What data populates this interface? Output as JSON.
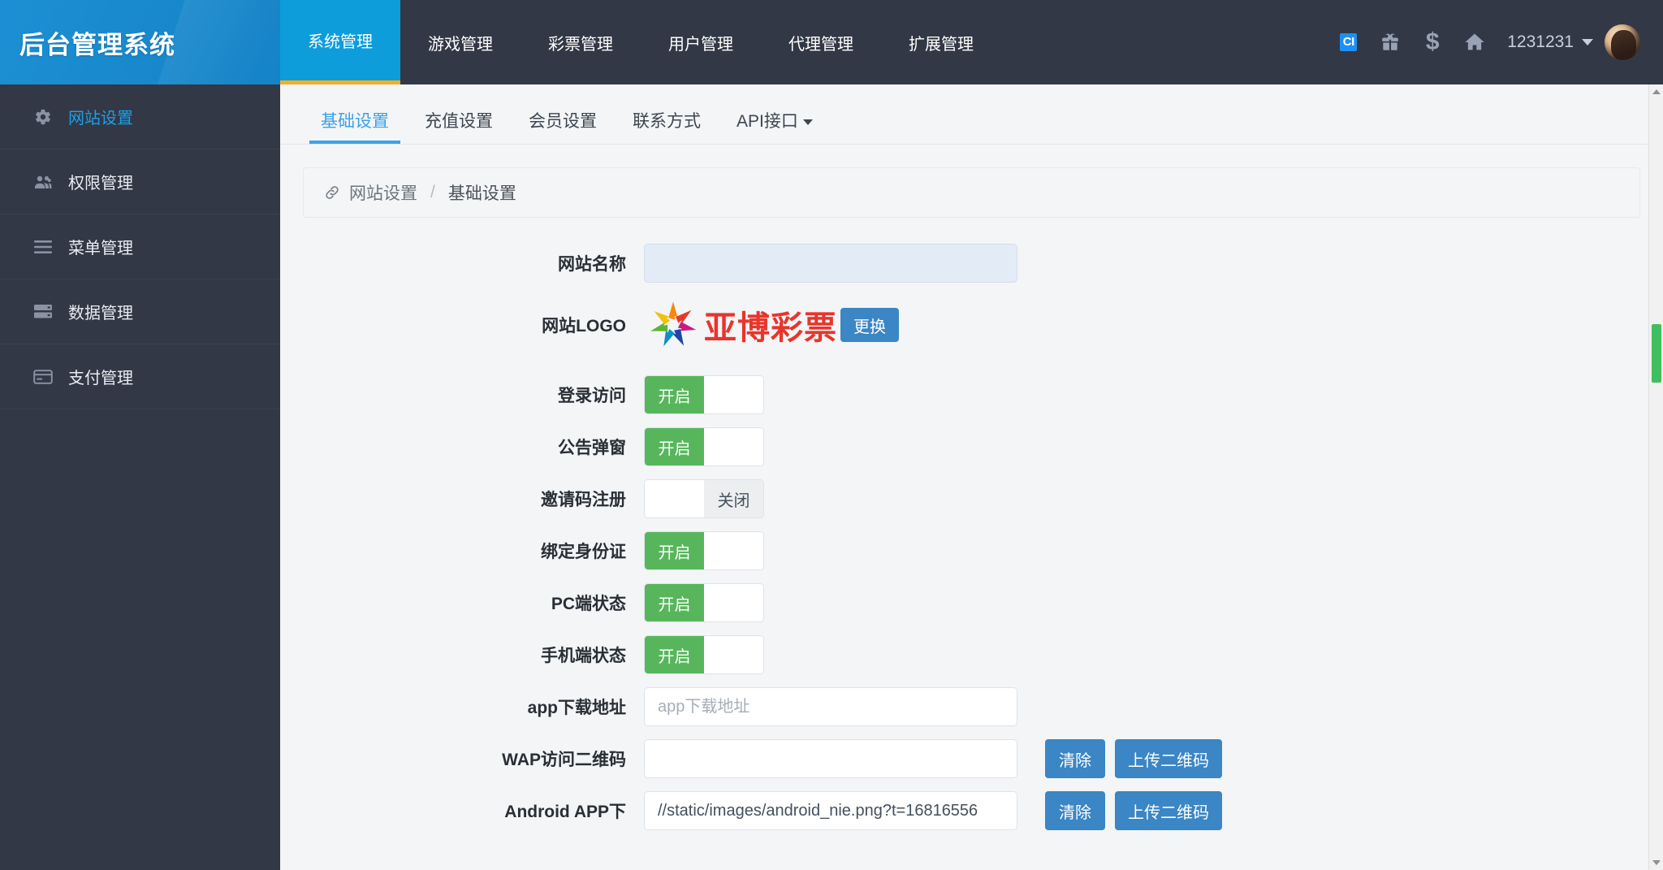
{
  "brand": {
    "title": "后台管理系统"
  },
  "topnav": {
    "items": [
      {
        "label": "系统管理",
        "active": true
      },
      {
        "label": "游戏管理",
        "active": false
      },
      {
        "label": "彩票管理",
        "active": false
      },
      {
        "label": "用户管理",
        "active": false
      },
      {
        "label": "代理管理",
        "active": false
      },
      {
        "label": "扩展管理",
        "active": false
      }
    ],
    "icons": [
      {
        "name": "ci-badge-icon",
        "label": "CI"
      },
      {
        "name": "gift-icon",
        "label": ""
      },
      {
        "name": "dollar-icon",
        "label": "$"
      },
      {
        "name": "home-icon",
        "label": ""
      }
    ],
    "username": "1231231"
  },
  "sidebar": {
    "items": [
      {
        "label": "网站设置",
        "icon": "gear-icon",
        "active": true
      },
      {
        "label": "权限管理",
        "icon": "users-icon",
        "active": false
      },
      {
        "label": "菜单管理",
        "icon": "list-icon",
        "active": false
      },
      {
        "label": "数据管理",
        "icon": "server-icon",
        "active": false
      },
      {
        "label": "支付管理",
        "icon": "credit-card-icon",
        "active": false
      }
    ]
  },
  "subtabs": [
    {
      "label": "基础设置",
      "active": true,
      "caret": false
    },
    {
      "label": "充值设置",
      "active": false,
      "caret": false
    },
    {
      "label": "会员设置",
      "active": false,
      "caret": false
    },
    {
      "label": "联系方式",
      "active": false,
      "caret": false
    },
    {
      "label": "API接口",
      "active": false,
      "caret": true
    }
  ],
  "breadcrumb": {
    "icon": "link-icon",
    "parent": "网站设置",
    "separator": "/",
    "current": "基础设置"
  },
  "form": {
    "rows": [
      {
        "label": "网站名称",
        "type": "input",
        "value": "",
        "placeholder": "",
        "autofill": true
      },
      {
        "label": "网站LOGO",
        "type": "logo",
        "logo_text": "亚博彩票",
        "button": "更换"
      },
      {
        "label": "登录访问",
        "type": "toggle",
        "state": "on",
        "on_label": "开启",
        "off_label": "关闭"
      },
      {
        "label": "公告弹窗",
        "type": "toggle",
        "state": "on",
        "on_label": "开启",
        "off_label": "关闭"
      },
      {
        "label": "邀请码注册",
        "type": "toggle",
        "state": "off",
        "on_label": "开启",
        "off_label": "关闭"
      },
      {
        "label": "绑定身份证",
        "type": "toggle",
        "state": "on",
        "on_label": "开启",
        "off_label": "关闭"
      },
      {
        "label": "PC端状态",
        "type": "toggle",
        "state": "on",
        "on_label": "开启",
        "off_label": "关闭"
      },
      {
        "label": "手机端状态",
        "type": "toggle",
        "state": "on",
        "on_label": "开启",
        "off_label": "关闭"
      },
      {
        "label": "app下载地址",
        "type": "input",
        "value": "",
        "placeholder": "app下载地址",
        "autofill": false
      },
      {
        "label": "WAP访问二维码",
        "type": "input_buttons",
        "value": "",
        "placeholder": "",
        "buttons": [
          "清除",
          "上传二维码"
        ]
      },
      {
        "label": "Android APP下",
        "type": "input_buttons",
        "value": "//static/images/android_nie.png?t=16816556",
        "placeholder": "",
        "buttons": [
          "清除",
          "上传二维码"
        ]
      }
    ]
  },
  "colors": {
    "brand_blue": "#1a8ace",
    "nav_active": "#0d9ddb",
    "nav_underline": "#f5ae28",
    "sidebar_bg": "#323845",
    "link_blue": "#3ea1e8",
    "toggle_on": "#57b65c",
    "button_blue": "#3b86c4",
    "logo_red": "#e8352c",
    "scroll_thumb": "#3fbf5f"
  }
}
